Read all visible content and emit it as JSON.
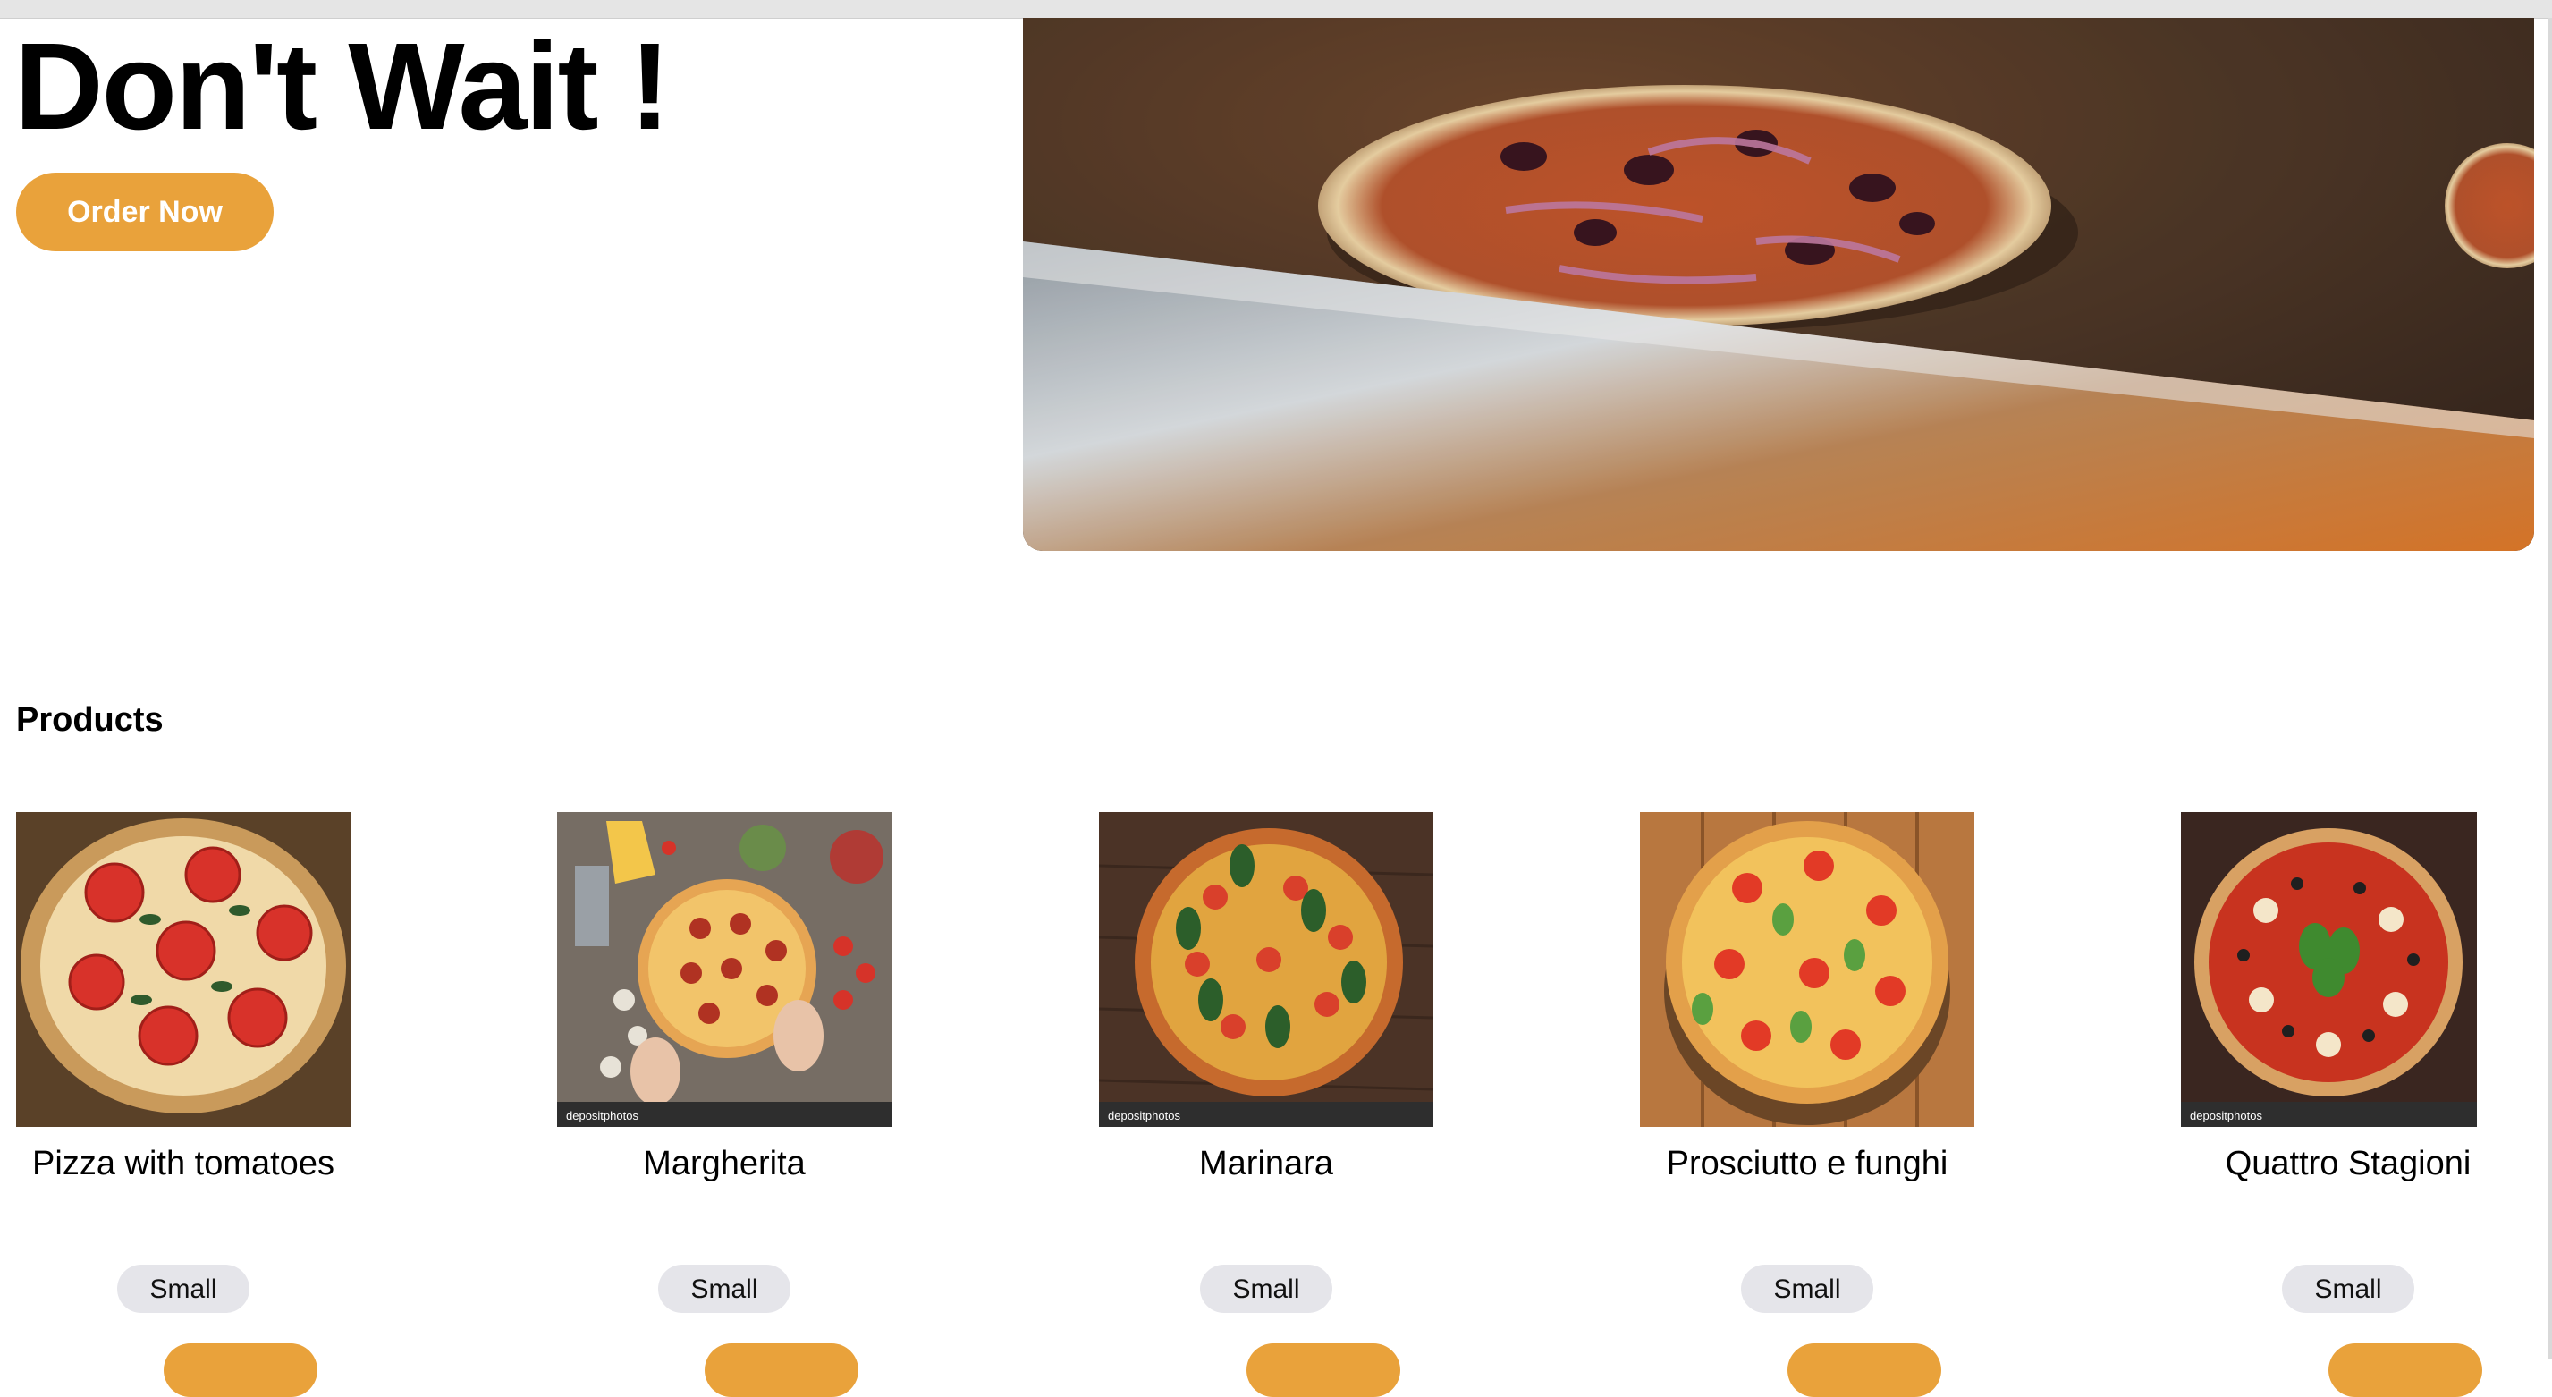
{
  "hero": {
    "title": "Don't Wait !",
    "order_button_label": "Order Now"
  },
  "products": {
    "heading": "Products",
    "items": [
      {
        "name": "Pizza with tomatoes",
        "size": "Small"
      },
      {
        "name": "Margherita",
        "size": "Small"
      },
      {
        "name": "Marinara",
        "size": "Small"
      },
      {
        "name": "Prosciutto e funghi",
        "size": "Small"
      },
      {
        "name": "Quattro Stagioni",
        "size": "Small"
      }
    ]
  },
  "colors": {
    "accent": "#e9a23b",
    "chip_bg": "#e5e5ea"
  }
}
